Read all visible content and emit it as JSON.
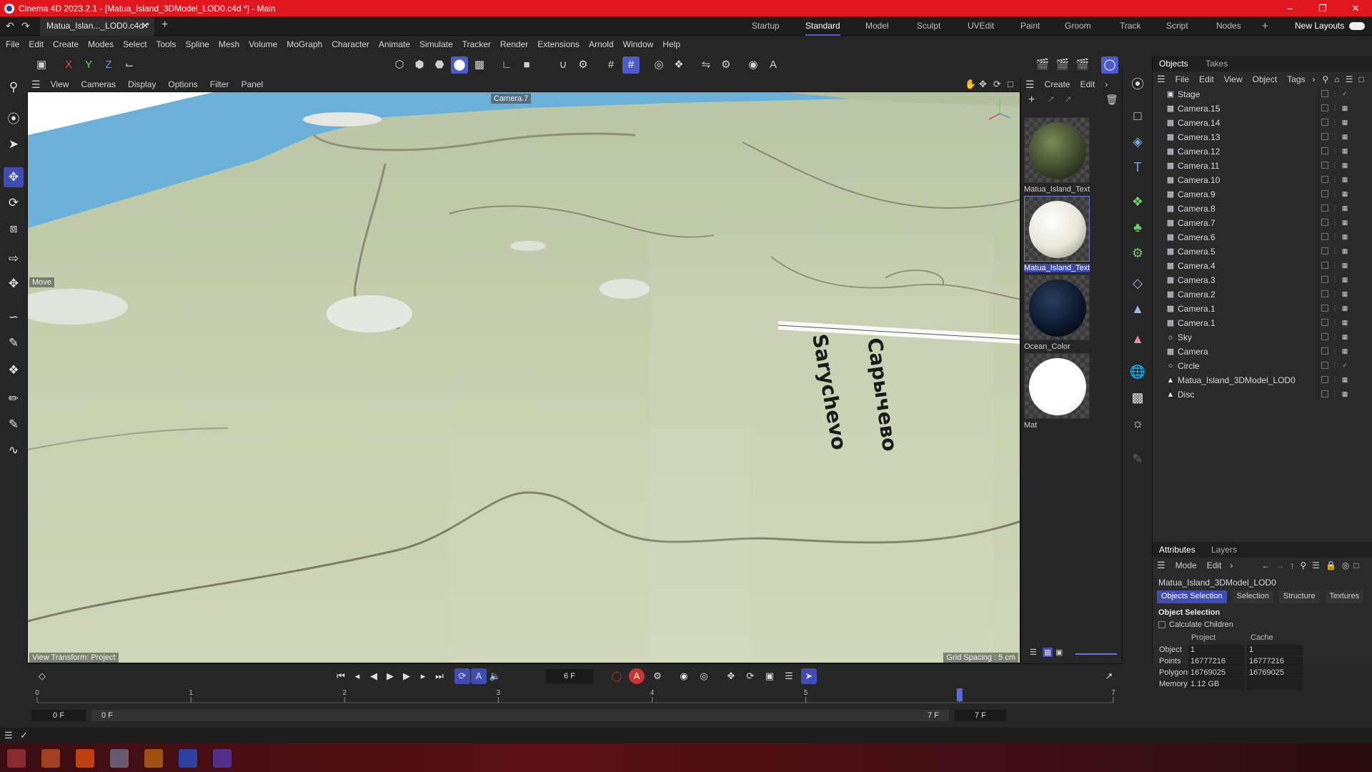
{
  "window": {
    "title": "Cinema 4D 2023.2.1 - [Matua_Island_3DModel_LOD0.c4d *] - Main"
  },
  "doc_tab": "Matua_Islan..._LOD0.c4d *",
  "layouts": [
    "Startup",
    "Standard",
    "Model",
    "Sculpt",
    "UVEdit",
    "Paint",
    "Groom",
    "Track",
    "Script",
    "Nodes"
  ],
  "active_layout": "Standard",
  "new_layouts": "New Layouts",
  "menu": [
    "File",
    "Edit",
    "Create",
    "Modes",
    "Select",
    "Tools",
    "Spline",
    "Mesh",
    "Volume",
    "MoGraph",
    "Character",
    "Animate",
    "Simulate",
    "Tracker",
    "Render",
    "Extensions",
    "Arnold",
    "Window",
    "Help"
  ],
  "axis_toggles": [
    "X",
    "Y",
    "Z"
  ],
  "viewport_menu": [
    "View",
    "Cameras",
    "Display",
    "Options",
    "Filter",
    "Panel"
  ],
  "viewport": {
    "camera": "Camera.7",
    "tool_label": "Move",
    "view_transform": "View Transform: Project",
    "grid_spacing": "Grid Spacing : 5 cm",
    "map_label_1": "Capычево",
    "map_label_2": "Sarychevo"
  },
  "material_menu": [
    "Create",
    "Edit"
  ],
  "materials": [
    {
      "name": "Matua_Island_Text",
      "color": "#3e4a2c"
    },
    {
      "name": "Matua_Island_Text",
      "color": "#e6e6d6"
    },
    {
      "name": "Ocean_Color",
      "color": "#0c1a2e"
    },
    {
      "name": "Mat",
      "color": "#ffffff"
    }
  ],
  "objects_panel": {
    "tabs": [
      "Objects",
      "Takes"
    ],
    "menu": [
      "File",
      "Edit",
      "View",
      "Object",
      "Tags"
    ],
    "items": [
      {
        "name": "Stage",
        "icon": "stage-icon"
      },
      {
        "name": "Camera.15",
        "icon": "camera-icon"
      },
      {
        "name": "Camera.14",
        "icon": "camera-icon"
      },
      {
        "name": "Camera.13",
        "icon": "camera-icon"
      },
      {
        "name": "Camera.12",
        "icon": "camera-icon"
      },
      {
        "name": "Camera.11",
        "icon": "camera-icon"
      },
      {
        "name": "Camera.10",
        "icon": "camera-icon"
      },
      {
        "name": "Camera.9",
        "icon": "camera-icon"
      },
      {
        "name": "Camera.8",
        "icon": "camera-icon"
      },
      {
        "name": "Camera.7",
        "icon": "camera-icon"
      },
      {
        "name": "Camera.6",
        "icon": "camera-icon"
      },
      {
        "name": "Camera.5",
        "icon": "camera-icon"
      },
      {
        "name": "Camera.4",
        "icon": "camera-icon"
      },
      {
        "name": "Camera.3",
        "icon": "camera-icon"
      },
      {
        "name": "Camera.2",
        "icon": "camera-icon"
      },
      {
        "name": "Camera.1",
        "icon": "camera-icon"
      },
      {
        "name": "Camera.1",
        "icon": "camera-icon"
      },
      {
        "name": "Sky",
        "icon": "sky-icon"
      },
      {
        "name": "Camera",
        "icon": "camera-icon"
      },
      {
        "name": "Circle",
        "icon": "circle-icon"
      },
      {
        "name": "Matua_Island_3DModel_LOD0",
        "icon": "polygon-icon"
      },
      {
        "name": "Disc",
        "icon": "polygon-icon"
      }
    ]
  },
  "attributes": {
    "tabs": [
      "Attributes",
      "Layers"
    ],
    "menu": [
      "Mode",
      "Edit"
    ],
    "object_name": "Matua_Island_3DModel_LOD0",
    "subtabs": [
      "Objects Selection",
      "Selection",
      "Structure",
      "Textures"
    ],
    "section": "Object Selection",
    "calculate_children": "Calculate Children",
    "columns": [
      "Project",
      "Cache"
    ],
    "rows": [
      {
        "label": "Object",
        "project": "1",
        "cache": "1"
      },
      {
        "label": "Points",
        "project": "16777216",
        "cache": "16777216"
      },
      {
        "label": "Polygons",
        "project": "16769025",
        "cache": "16769025"
      },
      {
        "label": "Memory",
        "project": "1.12 GB",
        "cache": ""
      }
    ]
  },
  "timeline": {
    "current_frame": "6 F",
    "start": "0 F",
    "start2": "0 F",
    "end": "7 F",
    "end2": "7 F",
    "ticks": [
      "0",
      "1",
      "2",
      "3",
      "4",
      "5",
      "6",
      "7"
    ],
    "playhead_frame": 6,
    "max_frame": 7
  }
}
